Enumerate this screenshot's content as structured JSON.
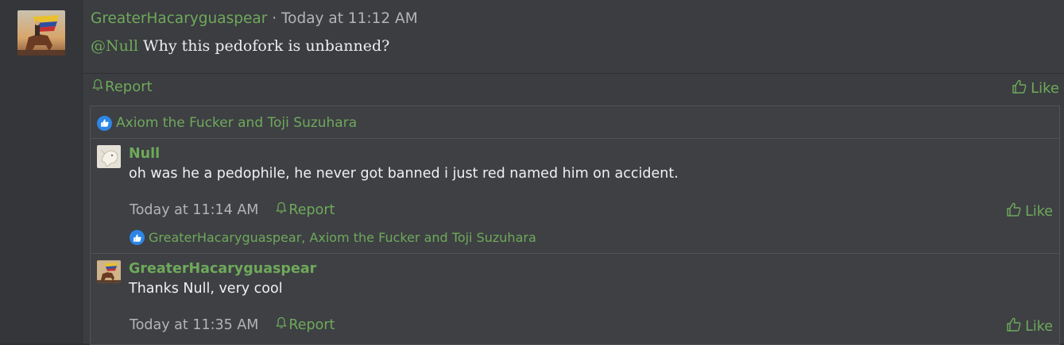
{
  "post": {
    "author": "GreaterHacaryguaspear",
    "separator": " · ",
    "time": "Today at 11:12 AM",
    "mention": "@Null",
    "body": " Why this pedofork is unbanned?",
    "report_label": "Report",
    "like_label": "Like",
    "reactions_text": "Axiom the Fucker and Toji Suzuhara"
  },
  "comments": [
    {
      "author": "Null",
      "text": "oh was he a pedophile, he never got banned i just red named him on accident.",
      "time": "Today at 11:14 AM",
      "report_label": "Report",
      "like_label": "Like",
      "reactions_text": "GreaterHacaryguaspear, Axiom the Fucker and Toji Suzuhara"
    },
    {
      "author": "GreaterHacaryguaspear",
      "text": "Thanks Null, very cool",
      "time": "Today at 11:35 AM",
      "report_label": "Report",
      "like_label": "Like"
    }
  ],
  "colors": {
    "accent_green": "#6fa95a",
    "like_badge_blue": "#2d86e6",
    "background": "#3b3d41"
  },
  "icons": [
    "bell-icon",
    "thumbs-up-icon",
    "like-reaction-badge-icon"
  ]
}
